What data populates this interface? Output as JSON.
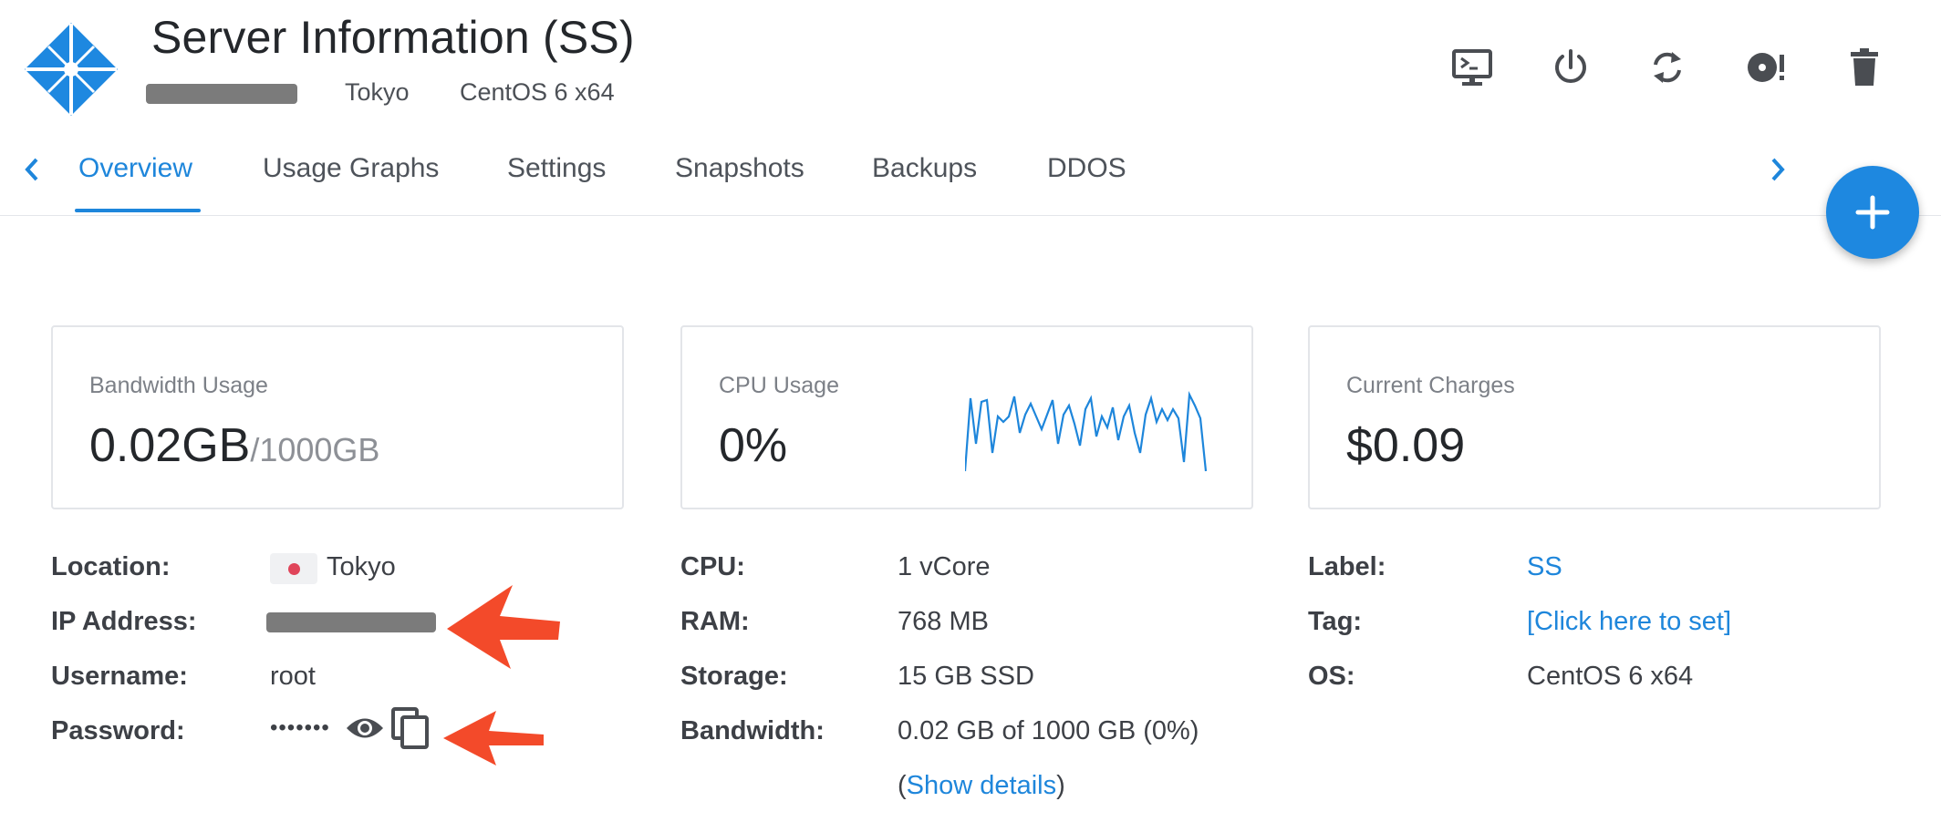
{
  "header": {
    "title": "Server Information (SS)",
    "location": "Tokyo",
    "os": "CentOS 6 x64",
    "actions": [
      "console-icon",
      "power-icon",
      "restart-icon",
      "reinstall-icon",
      "trash-icon"
    ]
  },
  "tabs": [
    {
      "label": "Overview",
      "active": true
    },
    {
      "label": "Usage Graphs",
      "active": false
    },
    {
      "label": "Settings",
      "active": false
    },
    {
      "label": "Snapshots",
      "active": false
    },
    {
      "label": "Backups",
      "active": false
    },
    {
      "label": "DDOS",
      "active": false
    }
  ],
  "fab": {
    "label": "+"
  },
  "cards": {
    "bandwidth": {
      "label": "Bandwidth Usage",
      "value": "0.02GB",
      "unit": "/1000GB"
    },
    "cpu": {
      "label": "CPU Usage",
      "value": "0%",
      "sparkline_color": "#1e86db"
    },
    "charges": {
      "label": "Current Charges",
      "value": "$0.09"
    }
  },
  "details_left": {
    "location_label": "Location:",
    "location_value": "Tokyo",
    "ip_label": "IP Address:",
    "username_label": "Username:",
    "username_value": "root",
    "password_label": "Password:",
    "password_value": "•••••••"
  },
  "details_mid": {
    "cpu_label": "CPU:",
    "cpu_value": "1 vCore",
    "ram_label": "RAM:",
    "ram_value": "768 MB",
    "storage_label": "Storage:",
    "storage_value": "15 GB SSD",
    "bandwidth_label": "Bandwidth:",
    "bandwidth_value": "0.02 GB of 1000 GB (0%)",
    "show_details_open": "(",
    "show_details": "Show details",
    "show_details_close": ")"
  },
  "details_right": {
    "label_label": "Label:",
    "label_value": "SS",
    "tag_label": "Tag:",
    "tag_value": "[Click here to set]",
    "os_label": "OS:",
    "os_value": "CentOS 6 x64"
  },
  "colors": {
    "accent": "#1e86db",
    "annotation": "#f34a2a"
  }
}
